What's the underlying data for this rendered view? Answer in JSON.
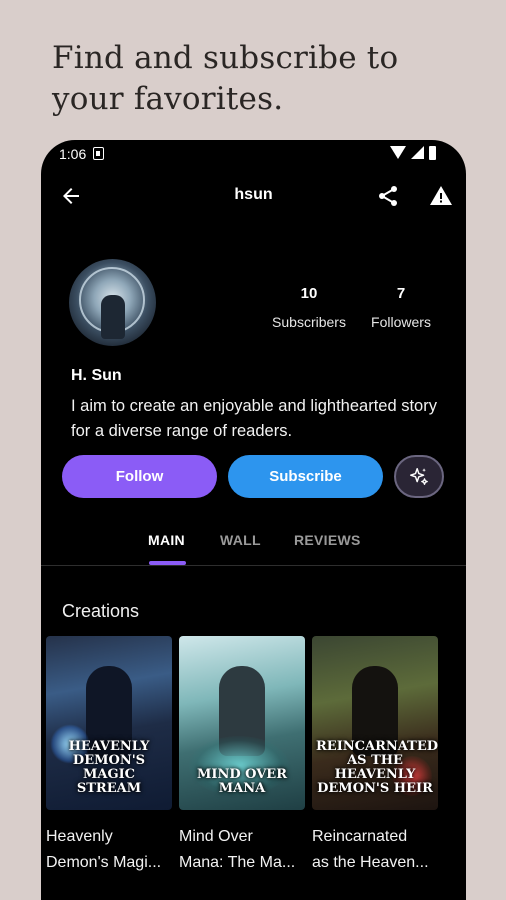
{
  "promo": {
    "line1": "Find and subscribe to",
    "line2": "your favorites."
  },
  "status_bar": {
    "time": "1:06"
  },
  "app_bar": {
    "title": "hsun"
  },
  "profile": {
    "subscribers_count": "10",
    "subscribers_label": "Subscribers",
    "followers_count": "7",
    "followers_label": "Followers",
    "name": "H. Sun",
    "bio": "I aim to create an enjoyable and lighthearted story for a diverse range of readers."
  },
  "actions": {
    "follow_label": "Follow",
    "subscribe_label": "Subscribe"
  },
  "tabs": [
    {
      "label": "MAIN"
    },
    {
      "label": "WALL"
    },
    {
      "label": "REVIEWS"
    }
  ],
  "creations": {
    "title": "Creations",
    "items": [
      {
        "title_line1": "Heavenly",
        "title_line2": "Demon's Magi...",
        "cover_text": "HEAVENLY DEMON'S MAGIC STREAM"
      },
      {
        "title_line1": "Mind Over",
        "title_line2": "Mana: The Ma...",
        "cover_text": "MIND OVER MANA"
      },
      {
        "title_line1": "Reincarnated",
        "title_line2": "as the Heaven...",
        "cover_text": "REINCARNATED AS THE HEAVENLY DEMON'S HEIR"
      }
    ]
  },
  "colors": {
    "accent_purple": "#8b5cf6",
    "accent_blue": "#2d95ee",
    "background": "#000000",
    "page_background": "#d9cecb"
  }
}
